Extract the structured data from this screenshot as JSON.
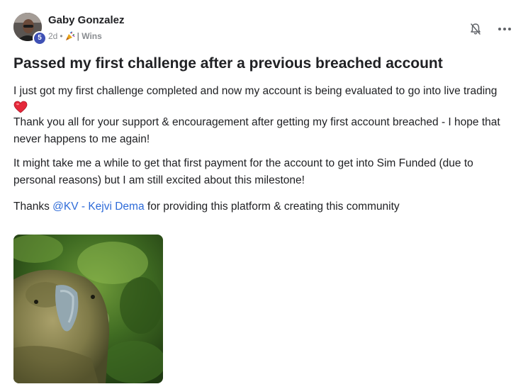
{
  "author": {
    "name": "Gaby Gonzalez",
    "level": "5",
    "time_ago": "2d",
    "category_icon": "party-popper-icon",
    "category": "| Wins"
  },
  "post": {
    "title": "Passed my first challenge after a previous breached account",
    "paragraph1_line1": "I just got my first challenge completed and now my account is being evaluated to go into live trading",
    "paragraph1_line2": "Thank you all for your support & encouragement after getting my first account breached - I hope that never happens to me again!",
    "paragraph2": "It might take me a while to get that first payment for the account to get into Sim Funded (due to personal reasons) but I am still excited about this milestone!",
    "paragraph3_prefix": "Thanks ",
    "mention": "@KV - Kejvi Dema",
    "paragraph3_suffix": " for providing this platform & creating this community"
  },
  "icons": {
    "heart": "red-heart-emoji",
    "bell": "bell-off-icon",
    "more": "more-horizontal-icon"
  },
  "colors": {
    "mention": "#2e6bd8",
    "level_badge": "#3f51b5",
    "meta_text": "#8a8d91"
  }
}
